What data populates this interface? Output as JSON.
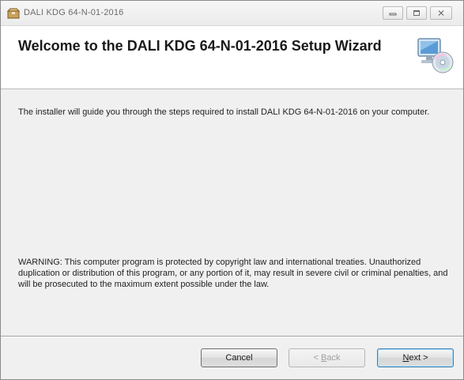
{
  "window": {
    "title": "DALI KDG 64-N-01-2016",
    "icons": {
      "app": "installer-box-icon",
      "minimize": "minimize-icon",
      "maximize": "maximize-icon",
      "close": "close-icon",
      "banner": "computer-cd-icon"
    }
  },
  "banner": {
    "title": "Welcome to the DALI KDG 64-N-01-2016 Setup Wizard"
  },
  "body": {
    "intro": "The installer will guide you through the steps required to install DALI KDG 64-N-01-2016 on your computer.",
    "warning": "WARNING: This computer program is protected by copyright law and international treaties. Unauthorized duplication or distribution of this program, or any portion of it, may result in severe civil or criminal penalties, and will be prosecuted to the maximum extent possible under the law."
  },
  "buttons": {
    "cancel": "Cancel",
    "back_pre": "< ",
    "back_mnemonic": "B",
    "back_post": "ack",
    "next_mnemonic": "N",
    "next_post": "ext >"
  },
  "colors": {
    "window_bg": "#f0f0f0",
    "banner_bg": "#ffffff",
    "default_button_border": "#3c7fb1"
  }
}
